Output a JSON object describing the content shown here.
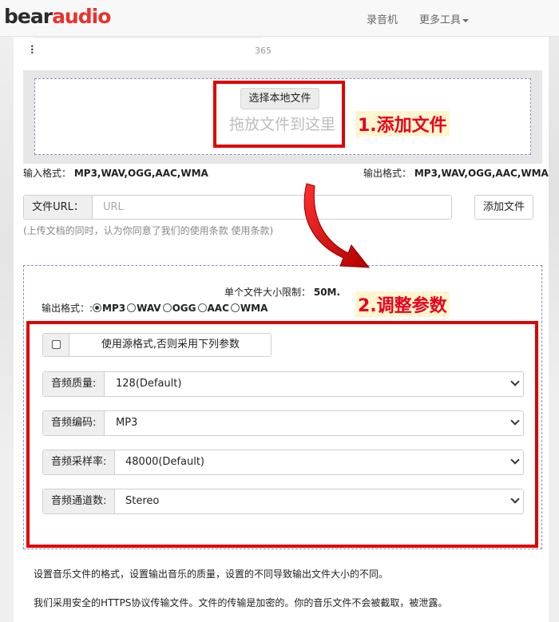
{
  "nav": {
    "logo_part1": "bear",
    "logo_part2": "audio",
    "items": [
      "录音机",
      "更多工具"
    ]
  },
  "player": {
    "count": "365"
  },
  "upload": {
    "choose_label": "选择本地文件",
    "drop_text": "拖放文件到这里"
  },
  "annotations": {
    "step1": "1.添加文件",
    "step2": "2.调整参数"
  },
  "formats": {
    "input_label": "输入格式：",
    "input_value": "MP3,WAV,OGG,AAC,WMA",
    "output_label": "输出格式：",
    "output_value": "MP3,WAV,OGG,AAC,WMA"
  },
  "url": {
    "label": "文件URL：",
    "placeholder": "URL",
    "value": "",
    "add_button": "添加文件",
    "terms": "(上传文档的同时，认为你同意了我们的使用条款 使用条款)"
  },
  "params": {
    "size_limit_label": "单个文件大小限制：",
    "size_limit_value": "50M.",
    "output_format_label": "输出格式：:",
    "format_options": [
      "MP3",
      "WAV",
      "OGG",
      "AAC",
      "WMA"
    ],
    "selected_format": "MP3",
    "use_source_label": "使用源格式,否则采用下列参数",
    "use_source_checked": false,
    "quality_label": "音频质量:",
    "quality_value": "128(Default)",
    "codec_label": "音频编码:",
    "codec_value": "MP3",
    "sample_rate_label": "音频采样率:",
    "sample_rate_value": "48000(Default)",
    "channels_label": "音频通道数:",
    "channels_value": "Stereo"
  },
  "descriptions": {
    "line1": "设置音乐文件的格式，设置输出音乐的质量，设置的不同导致输出文件大小的不同。",
    "line2": "我们采用安全的HTTPS协议传输文件。文件的传输是加密的。你的音乐文件不会被截取，被泄露。"
  },
  "colors": {
    "brand_red": "#e8322b",
    "annotation_red": "#e00000",
    "annotation_bg": "#fff6cf"
  }
}
